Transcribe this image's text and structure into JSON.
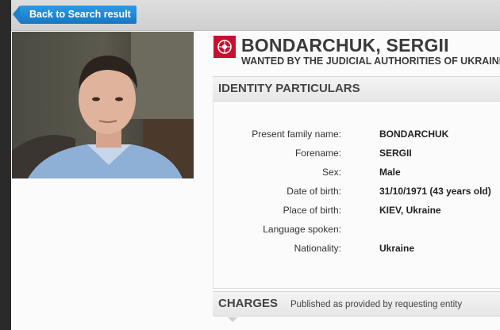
{
  "nav": {
    "back_label": "Back to Search result"
  },
  "notice": {
    "name": "BONDARCHUK, SERGII",
    "wanted_by": "WANTED BY THE JUDICIAL AUTHORITIES OF UKRAINE",
    "photo_alt": "Photo of BONDARCHUK, SERGII"
  },
  "identity": {
    "title": "IDENTITY PARTICULARS",
    "fields": [
      {
        "label": "Present family name:",
        "value": "BONDARCHUK"
      },
      {
        "label": "Forename:",
        "value": "SERGII"
      },
      {
        "label": "Sex:",
        "value": "Male"
      },
      {
        "label": "Date of birth:",
        "value": "31/10/1971 (43 years old)"
      },
      {
        "label": "Place of birth:",
        "value": "KIEV, Ukraine"
      },
      {
        "label": "Language spoken:",
        "value": ""
      },
      {
        "label": "Nationality:",
        "value": "Ukraine"
      }
    ]
  },
  "charges": {
    "title": "CHARGES",
    "note": "Published as provided by requesting entity"
  },
  "colors": {
    "brand": "#c8102e",
    "button": "#1a82cf"
  }
}
